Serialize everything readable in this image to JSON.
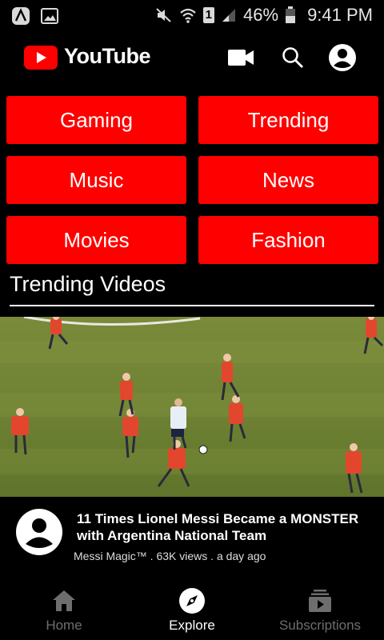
{
  "status_bar": {
    "sim_badge": "1",
    "battery": "46%",
    "time": "9:41 PM"
  },
  "header": {
    "title": "YouTube"
  },
  "categories": [
    "Gaming",
    "Trending",
    "Music",
    "News",
    "Movies",
    "Fashion"
  ],
  "section": {
    "title": "Trending Videos"
  },
  "video": {
    "title": "11 Times Lionel Messi Became a MONSTER with Argentina National Team",
    "meta": "Messi Magic™ . 63K views . a day ago"
  },
  "bottom_nav": {
    "items": [
      {
        "label": "Home",
        "icon": "home-icon",
        "active": false
      },
      {
        "label": "Explore",
        "icon": "compass-icon",
        "active": true
      },
      {
        "label": "Subscriptions",
        "icon": "subscriptions-icon",
        "active": false
      }
    ]
  },
  "colors": {
    "accent": "#ff0000",
    "background": "#000000",
    "inactive": "#6e6e6e"
  }
}
